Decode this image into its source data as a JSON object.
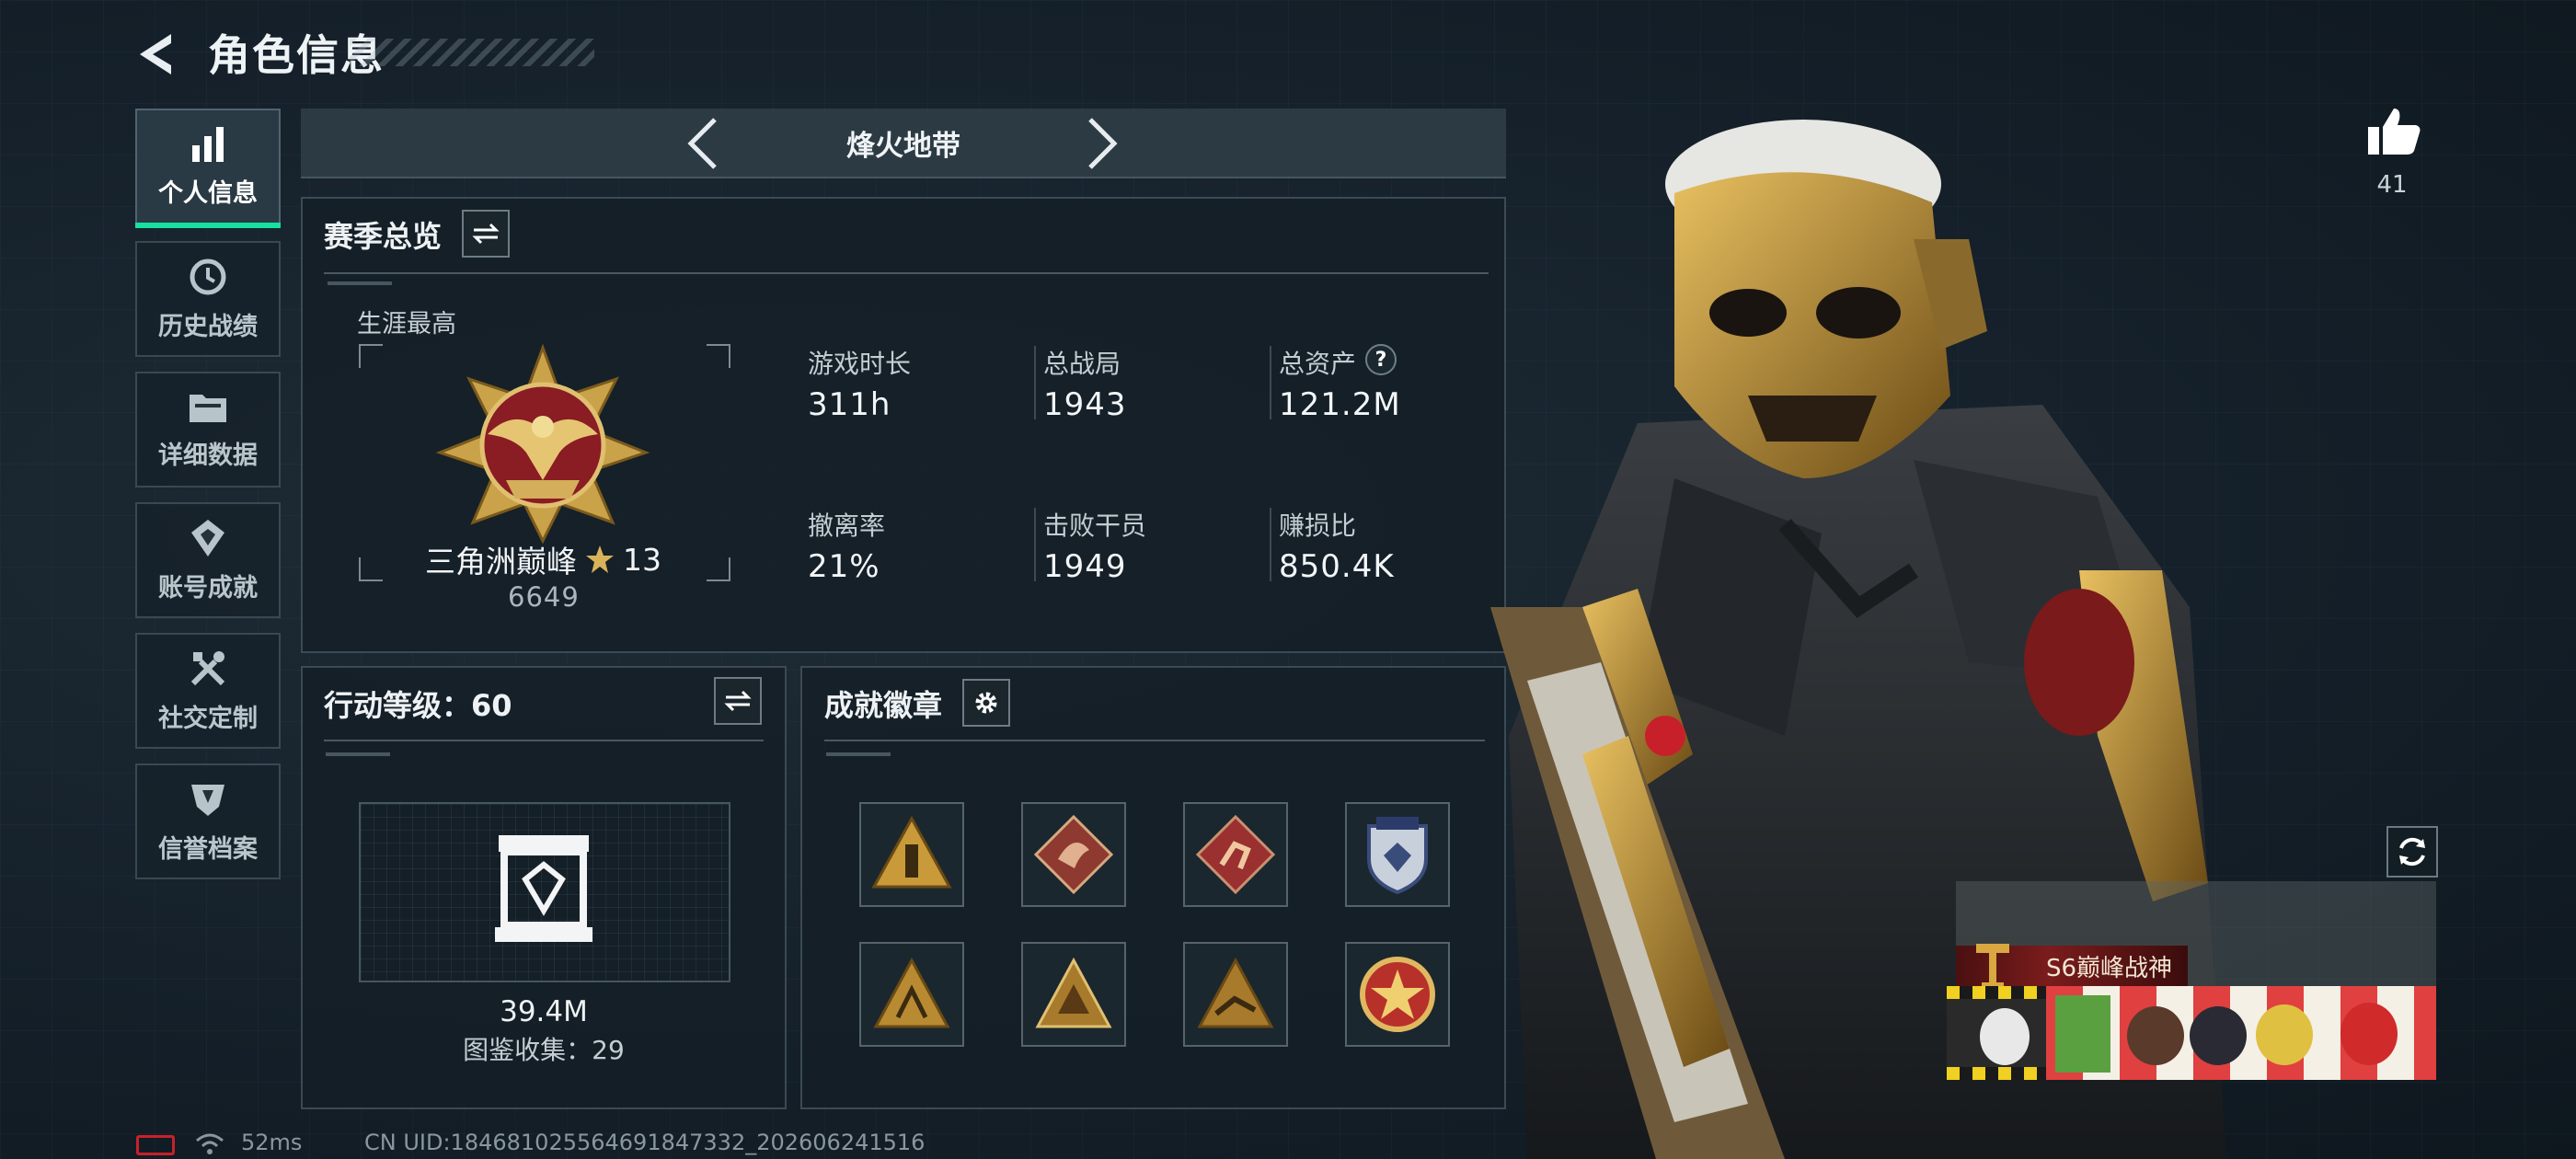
{
  "header": {
    "title": "角色信息"
  },
  "nav": {
    "items": [
      {
        "label": "个人信息",
        "icon": "bar-chart-icon",
        "active": true
      },
      {
        "label": "历史战绩",
        "icon": "history-icon",
        "active": false
      },
      {
        "label": "详细数据",
        "icon": "folder-icon",
        "active": false
      },
      {
        "label": "账号成就",
        "icon": "achievement-icon",
        "active": false
      },
      {
        "label": "社交定制",
        "icon": "tools-icon",
        "active": false
      },
      {
        "label": "信誉档案",
        "icon": "shield-icon",
        "active": false
      }
    ]
  },
  "mode": {
    "title": "烽火地带"
  },
  "season": {
    "title": "赛季总览",
    "career_label": "生涯最高",
    "rank_name": "三角洲巅峰",
    "rank_stars": "13",
    "rank_score": "6649",
    "stats": [
      {
        "label": "游戏时长",
        "value": "311h"
      },
      {
        "label": "总战局",
        "value": "1943"
      },
      {
        "label": "总资产",
        "value": "121.2M",
        "help": "?"
      },
      {
        "label": "撤离率",
        "value": "21%"
      },
      {
        "label": "击败干员",
        "value": "1949"
      },
      {
        "label": "赚损比",
        "value": "850.4K"
      }
    ]
  },
  "action": {
    "title": "行动等级：60",
    "value": "39.4M",
    "collection_label": "图鉴收集：29"
  },
  "badges": {
    "title": "成就徽章",
    "items": [
      {
        "icon": "triangle-tower-badge-icon"
      },
      {
        "icon": "dragon-badge-icon"
      },
      {
        "icon": "runner-badge-icon"
      },
      {
        "icon": "police-shield-badge-icon"
      },
      {
        "icon": "pyramid-badge-icon"
      },
      {
        "icon": "triangle-emblem-badge-icon"
      },
      {
        "icon": "crawler-badge-icon"
      },
      {
        "icon": "star-medal-badge-icon"
      }
    ]
  },
  "profile": {
    "likes": "41",
    "title_banner": "S6巅峰战神"
  },
  "status_bar": {
    "ping": "52ms",
    "uid": "CN UID:18468102556469184733​2_202606241516"
  },
  "colors": {
    "accent": "#18e0a0",
    "gold": "#c9a24a",
    "panel_border": "#3b4a54"
  }
}
